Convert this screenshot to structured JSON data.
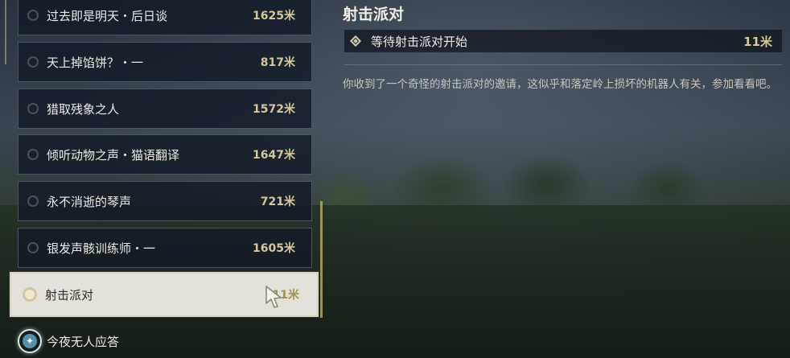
{
  "quest_list": {
    "items": [
      {
        "name": "过去即是明天・后日谈",
        "distance": "1625米"
      },
      {
        "name": "天上掉馅饼？・一",
        "distance": "817米"
      },
      {
        "name": "猎取残象之人",
        "distance": "1572米"
      },
      {
        "name": "倾听动物之声・猫语翻译",
        "distance": "1647米"
      },
      {
        "name": "永不消逝的琴声",
        "distance": "721米"
      },
      {
        "name": "银发声骸训练师・一",
        "distance": "1605米"
      }
    ],
    "selected": {
      "name": "射击派对",
      "distance": "11米"
    },
    "last": {
      "name": "今夜无人应答"
    }
  },
  "detail": {
    "title": "射击派对",
    "objective": {
      "text": "等待射击派对开始",
      "distance": "11米"
    },
    "description": "你收到了一个奇怪的射击派对的邀请，这似乎和落定岭上损坏的机器人有关，参加看看吧。"
  },
  "colors": {
    "accent": "#d6c79a",
    "selected_bg": "#ece9e2"
  }
}
